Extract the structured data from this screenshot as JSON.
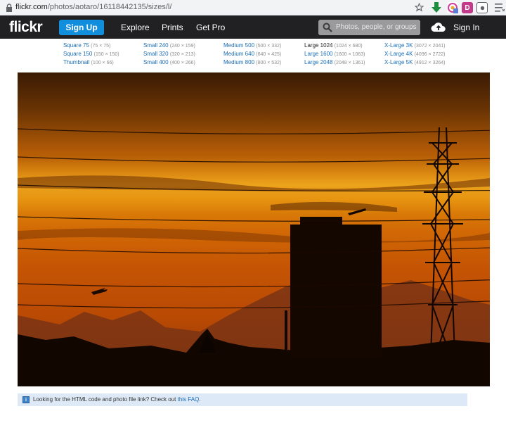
{
  "browser": {
    "url_host": "flickr.com",
    "url_path": "/photos/aotaro/16118442135/sizes/l/"
  },
  "nav": {
    "logo": "flickr",
    "signup": "Sign Up",
    "explore": "Explore",
    "prints": "Prints",
    "getpro": "Get Pro",
    "search_placeholder": "Photos, people, or groups",
    "signin": "Sign In"
  },
  "sizes": [
    {
      "label": "Square 75",
      "dims": "(75 × 75)"
    },
    {
      "label": "Square 150",
      "dims": "(150 × 150)"
    },
    {
      "label": "Thumbnail",
      "dims": "(100 × 66)"
    },
    {
      "label": "Small 240",
      "dims": "(240 × 159)"
    },
    {
      "label": "Small 320",
      "dims": "(320 × 213)"
    },
    {
      "label": "Small 400",
      "dims": "(400 × 266)"
    },
    {
      "label": "Medium 500",
      "dims": "(500 × 332)"
    },
    {
      "label": "Medium 640",
      "dims": "(640 × 425)"
    },
    {
      "label": "Medium 800",
      "dims": "(800 × 532)"
    },
    {
      "label": "Large 1024",
      "dims": "(1024 × 680)",
      "current": true
    },
    {
      "label": "Large 1600",
      "dims": "(1600 × 1063)"
    },
    {
      "label": "Large 2048",
      "dims": "(2048 × 1361)"
    },
    {
      "label": "X-Large 3K",
      "dims": "(3072 × 2041)"
    },
    {
      "label": "X-Large 4K",
      "dims": "(4096 × 2722)"
    },
    {
      "label": "X-Large 5K",
      "dims": "(4912 × 3264)"
    }
  ],
  "info": {
    "text": "Looking for the HTML code and photo file link? Check out ",
    "link": "this FAQ",
    "suffix": "."
  },
  "colors": {
    "nav_bg": "#212124",
    "signup_bg": "#128fdc",
    "link": "#1a6eb7",
    "info_bg": "#dde9f6"
  }
}
